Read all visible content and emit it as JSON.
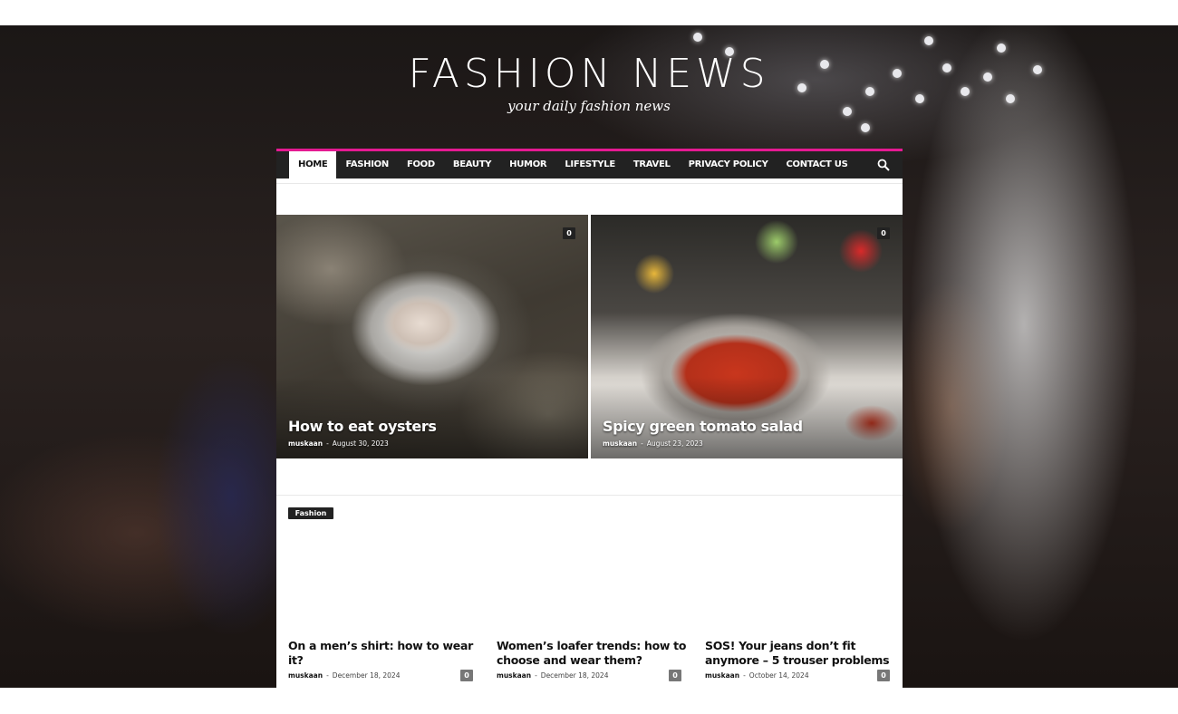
{
  "site": {
    "logo": "FASHION NEWS",
    "tagline": "your daily fashion news"
  },
  "colors": {
    "accent": "#e51a92",
    "nav_bg": "#222222"
  },
  "nav": {
    "items": [
      {
        "label": "HOME",
        "active": true
      },
      {
        "label": "FASHION"
      },
      {
        "label": "FOOD"
      },
      {
        "label": "BEAUTY"
      },
      {
        "label": "HUMOR"
      },
      {
        "label": "LIFESTYLE"
      },
      {
        "label": "TRAVEL"
      },
      {
        "label": "PRIVACY POLICY"
      },
      {
        "label": "CONTACT US"
      }
    ],
    "search_icon": "search-icon"
  },
  "featured": [
    {
      "title": "How to eat oysters",
      "author": "muskaan",
      "date": "August 30, 2023",
      "comments": "0"
    },
    {
      "title": "Spicy green tomato salad",
      "author": "muskaan",
      "date": "August 23, 2023",
      "comments": "0"
    }
  ],
  "category": {
    "label": "Fashion"
  },
  "posts": [
    {
      "title": "On a men’s shirt: how to wear it?",
      "author": "muskaan",
      "date": "December 18, 2024",
      "comments": "0"
    },
    {
      "title": "Women’s loafer trends: how to choose and wear them?",
      "author": "muskaan",
      "date": "December 18, 2024",
      "comments": "0"
    },
    {
      "title": "SOS! Your jeans don’t fit anymore – 5 trouser problems",
      "author": "muskaan",
      "date": "October 14, 2024",
      "comments": "0"
    }
  ],
  "separator": "-"
}
